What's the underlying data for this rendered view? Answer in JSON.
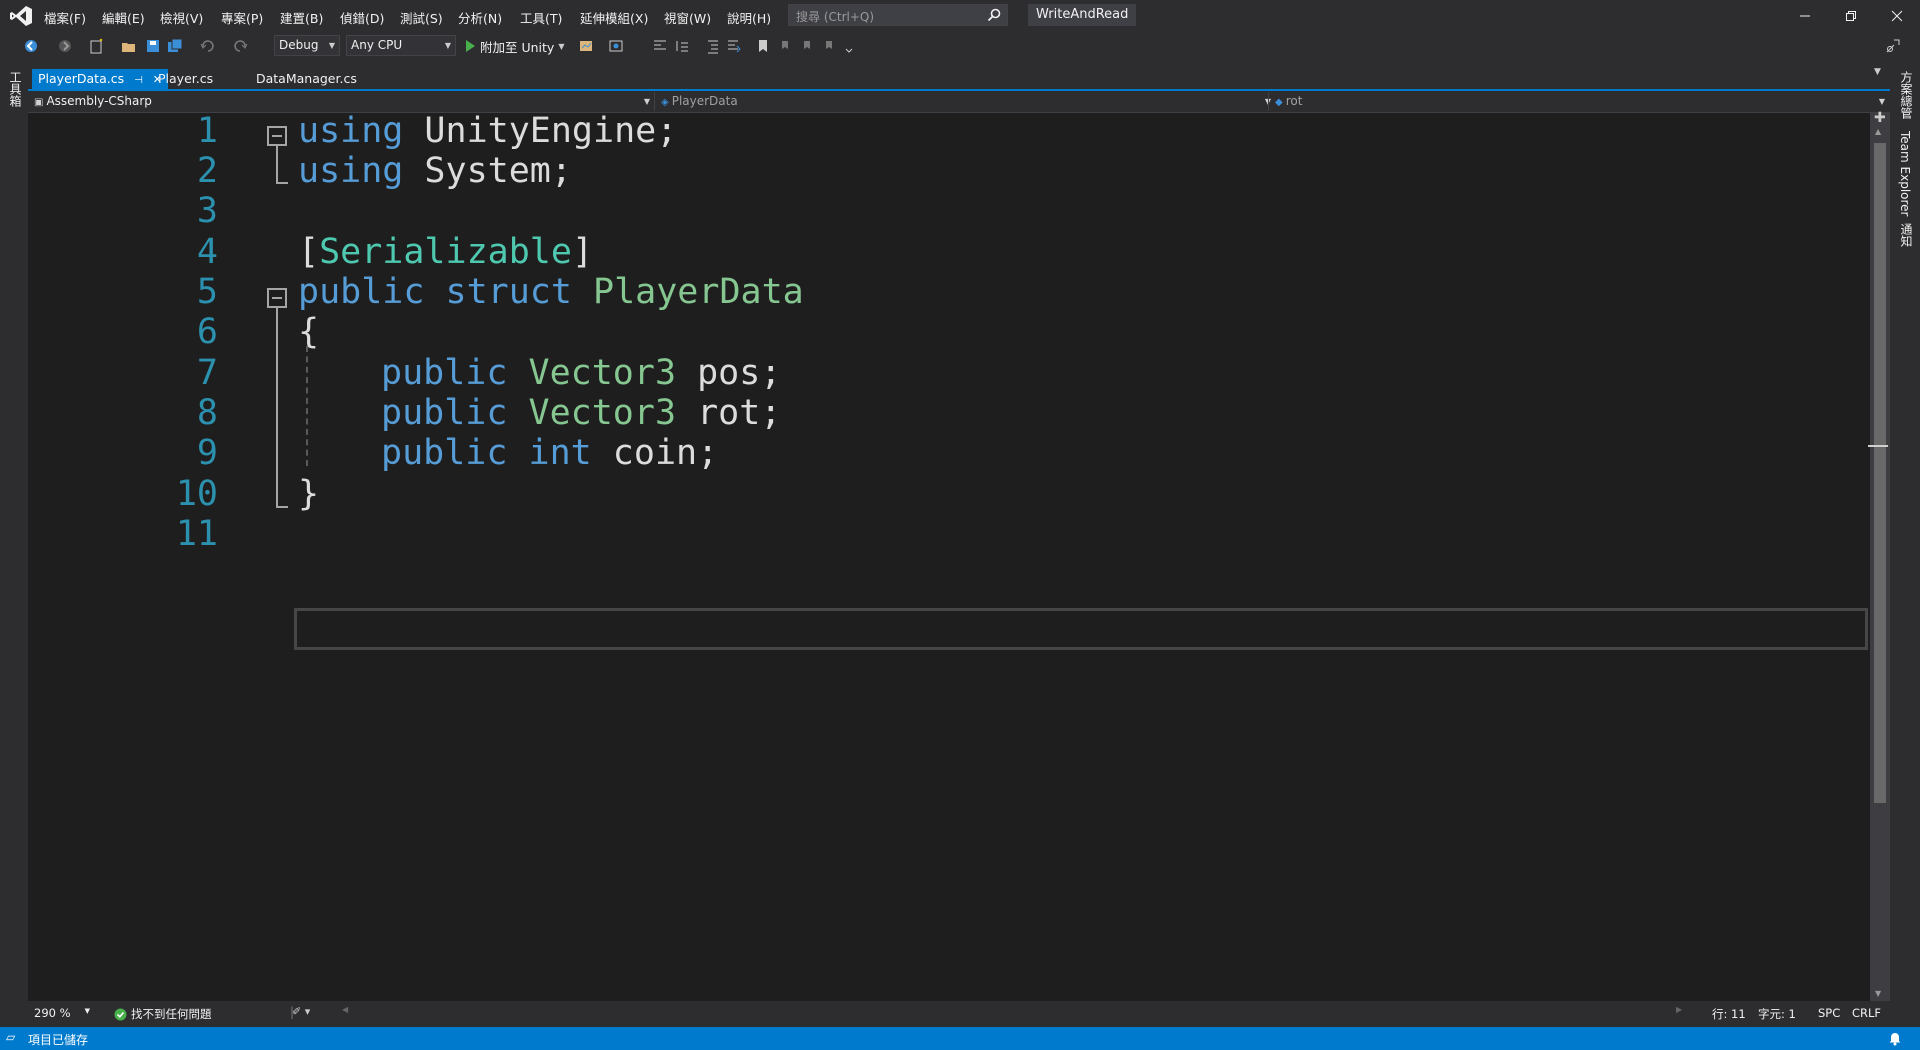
{
  "menu": {
    "items": [
      "檔案(F)",
      "編輯(E)",
      "檢視(V)",
      "專案(P)",
      "建置(B)",
      "偵錯(D)",
      "測試(S)",
      "分析(N)",
      "工具(T)",
      "延伸模組(X)",
      "視窗(W)",
      "說明(H)"
    ],
    "search_placeholder": "搜尋 (Ctrl+Q)",
    "solution_name": "WriteAndRead"
  },
  "toolbar": {
    "config": "Debug",
    "platform": "Any CPU",
    "attach_label": "附加至 Unity"
  },
  "left_strip": {
    "toolbox_label": "工具箱"
  },
  "right_strip": {
    "solution_explorer_label": "方案總管",
    "team_explorer_label": "Team Explorer",
    "notifications_label": "通知"
  },
  "tabs": [
    {
      "label": "PlayerData.cs",
      "active": true
    },
    {
      "label": "Player.cs",
      "active": false
    },
    {
      "label": "DataManager.cs",
      "active": false
    }
  ],
  "navbar": {
    "project": "Assembly-CSharp",
    "type": "PlayerData",
    "member": "rot"
  },
  "code": {
    "line_numbers": [
      "1",
      "2",
      "3",
      "4",
      "5",
      "6",
      "7",
      "8",
      "9",
      "10",
      "11"
    ],
    "l1": {
      "kw": "using",
      "rest": " UnityEngine;"
    },
    "l2": {
      "kw": "using",
      "rest": " System;"
    },
    "l4": {
      "open": "[",
      "attr": "Serializable",
      "close": "]"
    },
    "l5": {
      "kw1": "public",
      "kw2": " struct",
      "name": " PlayerData"
    },
    "l6": {
      "brace": "{"
    },
    "l7": {
      "kw": "public",
      "ty": " Vector3",
      "rest": " pos;"
    },
    "l8": {
      "kw": "public",
      "ty": " Vector3",
      "rest": " rot;"
    },
    "l9": {
      "kw": "public",
      "ty": " int",
      "rest": " coin;"
    },
    "l10": {
      "brace": "}"
    }
  },
  "editor_bottom": {
    "zoom": "290 %",
    "issues": "找不到任何問題",
    "line": "行: 11",
    "char": "字元: 1",
    "spc": "SPC",
    "crlf": "CRLF"
  },
  "status": {
    "message": "項目已儲存"
  },
  "colors": {
    "accent": "#007acc",
    "editor_bg": "#1e1e1e",
    "keyword": "#569cd6",
    "type": "#4ec9b0",
    "line_number": "#2b91af"
  }
}
